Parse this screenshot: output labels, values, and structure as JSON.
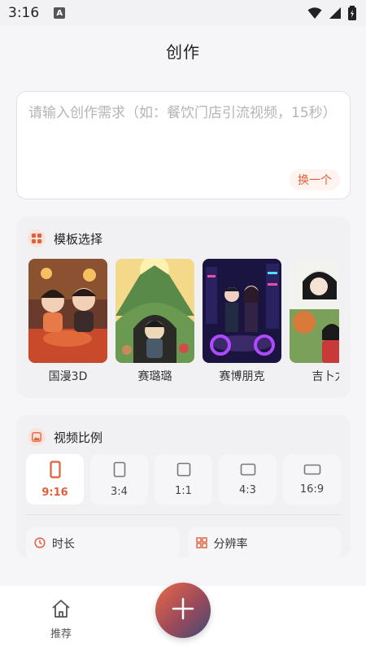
{
  "status_bar": {
    "time": "3:16",
    "notification_badge": "A"
  },
  "header": {
    "title": "创作"
  },
  "prompt": {
    "placeholder": "请输入创作需求（如：餐饮门店引流视频，15秒）",
    "swap_label": "换一个"
  },
  "templates": {
    "title": "模板选择",
    "items": [
      {
        "label": "国漫3D"
      },
      {
        "label": "赛璐璐"
      },
      {
        "label": "赛博朋克"
      },
      {
        "label": "吉卜力"
      }
    ]
  },
  "ratio": {
    "title": "视频比例",
    "options": [
      {
        "label": "9:16",
        "selected": true
      },
      {
        "label": "3:4",
        "selected": false
      },
      {
        "label": "1:1",
        "selected": false
      },
      {
        "label": "4:3",
        "selected": false
      },
      {
        "label": "16:9",
        "selected": false
      }
    ]
  },
  "settings": {
    "duration_label": "时长",
    "resolution_label": "分辨率"
  },
  "tabbar": {
    "home_label": "推荐"
  },
  "colors": {
    "accent": "#e0603c",
    "accent_bg": "#fff4ef"
  }
}
